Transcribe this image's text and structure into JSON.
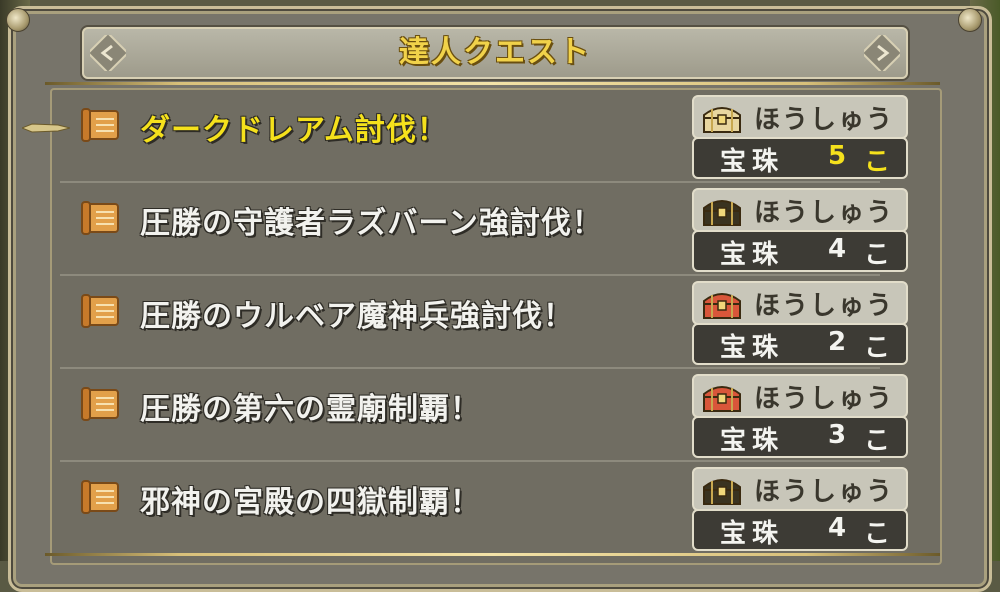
{
  "window": {
    "title": "達人クエスト"
  },
  "quests": [
    {
      "name": "ダークドレアム討伐！",
      "reward_label": "ほうしゅう",
      "reward_item": "宝珠",
      "reward_count": "5",
      "reward_unit": "こ",
      "chest": "gold-chest-sparkle-icon",
      "selected": true
    },
    {
      "name": "圧勝の守護者ラズバーン強討伐！",
      "reward_label": "ほうしゅう",
      "reward_item": "宝珠",
      "reward_count": "4",
      "reward_unit": "こ",
      "chest": "black-chest-icon",
      "selected": false
    },
    {
      "name": "圧勝のウルベア魔神兵強討伐！",
      "reward_label": "ほうしゅう",
      "reward_item": "宝珠",
      "reward_count": "2",
      "reward_unit": "こ",
      "chest": "red-chest-icon",
      "selected": false
    },
    {
      "name": "圧勝の第六の霊廟制覇！",
      "reward_label": "ほうしゅう",
      "reward_item": "宝珠",
      "reward_count": "3",
      "reward_unit": "こ",
      "chest": "red-chest-icon",
      "selected": false
    },
    {
      "name": "邪神の宮殿の四獄制覇！",
      "reward_label": "ほうしゅう",
      "reward_item": "宝珠",
      "reward_count": "4",
      "reward_unit": "こ",
      "chest": "black-chest-icon",
      "selected": false
    }
  ],
  "colors": {
    "selected_text": "#f5e11c",
    "title_text": "#f1d24a",
    "chest_gold": "#e8d6a0",
    "chest_black": "#3a3320",
    "chest_red": "#d9563a"
  }
}
